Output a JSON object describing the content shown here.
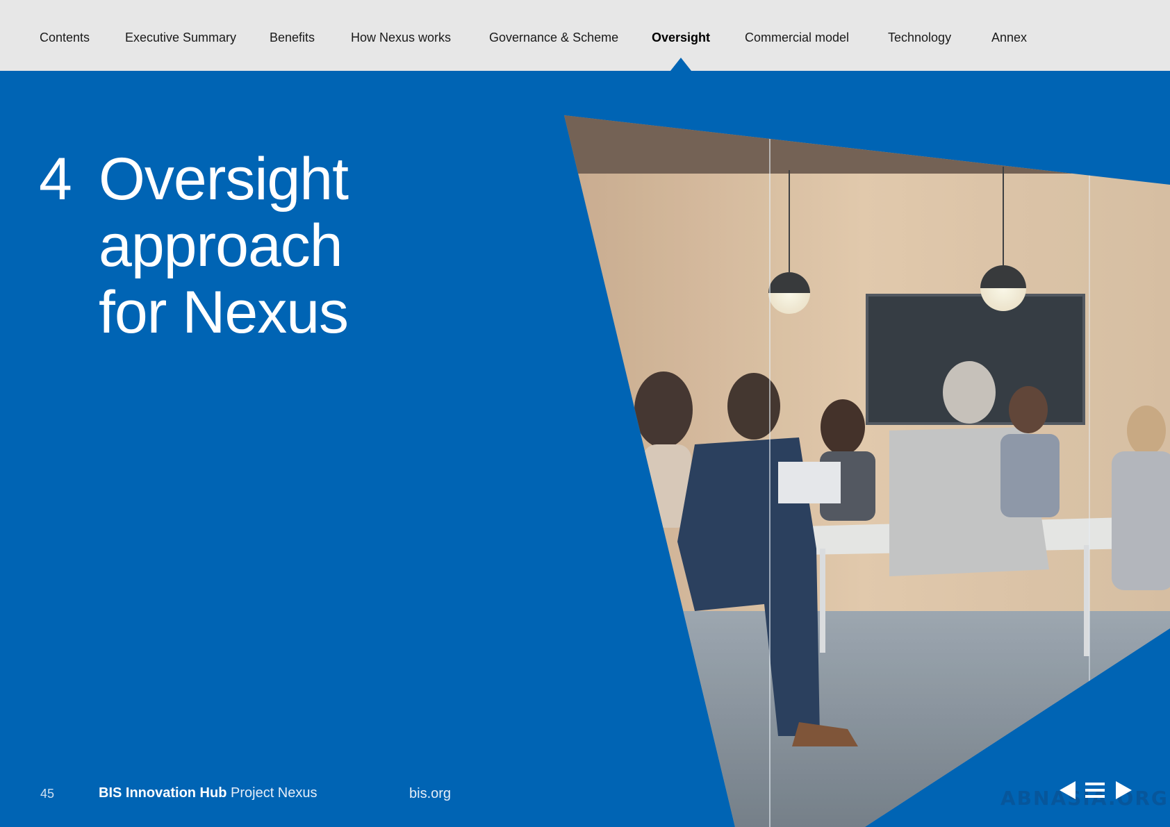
{
  "nav": {
    "items": [
      {
        "label": "Contents"
      },
      {
        "label": "Executive Summary"
      },
      {
        "label": "Benefits"
      },
      {
        "label": "How Nexus works"
      },
      {
        "label": "Governance & Scheme"
      },
      {
        "label": "Oversight"
      },
      {
        "label": "Commercial model"
      },
      {
        "label": "Technology"
      },
      {
        "label": "Annex"
      }
    ],
    "active_label": "Oversight"
  },
  "section": {
    "number": "4",
    "title_lines": [
      "Oversight",
      "approach",
      "for Nexus"
    ]
  },
  "footer": {
    "page_number": "45",
    "brand_bold": "BIS Innovation Hub",
    "brand_light": "Project Nexus",
    "site": "bis.org"
  },
  "watermark": "ABNASIA.ORG",
  "colors": {
    "brand_blue": "#0064b4",
    "nav_background": "#e7e7e7"
  },
  "icons": {
    "prev": "triangle-left-icon",
    "menu": "hamburger-menu-icon",
    "next": "triangle-right-icon"
  }
}
